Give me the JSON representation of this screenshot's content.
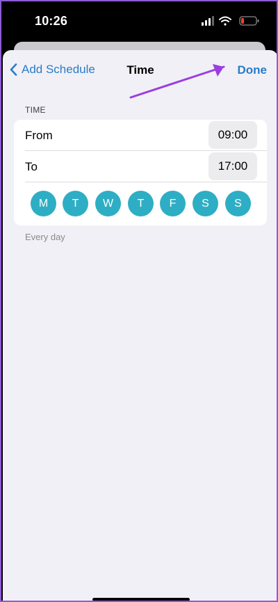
{
  "status": {
    "time": "10:26"
  },
  "nav": {
    "back_label": "Add Schedule",
    "title": "Time",
    "done_label": "Done"
  },
  "section": {
    "header": "TIME"
  },
  "rows": {
    "from": {
      "label": "From",
      "value": "09:00"
    },
    "to": {
      "label": "To",
      "value": "17:00"
    }
  },
  "days": [
    "M",
    "T",
    "W",
    "T",
    "F",
    "S",
    "S"
  ],
  "footnote": "Every day",
  "colors": {
    "accent": "#2a7cc7",
    "day_selected": "#2eaec4",
    "annotation": "#9a3ee0"
  }
}
